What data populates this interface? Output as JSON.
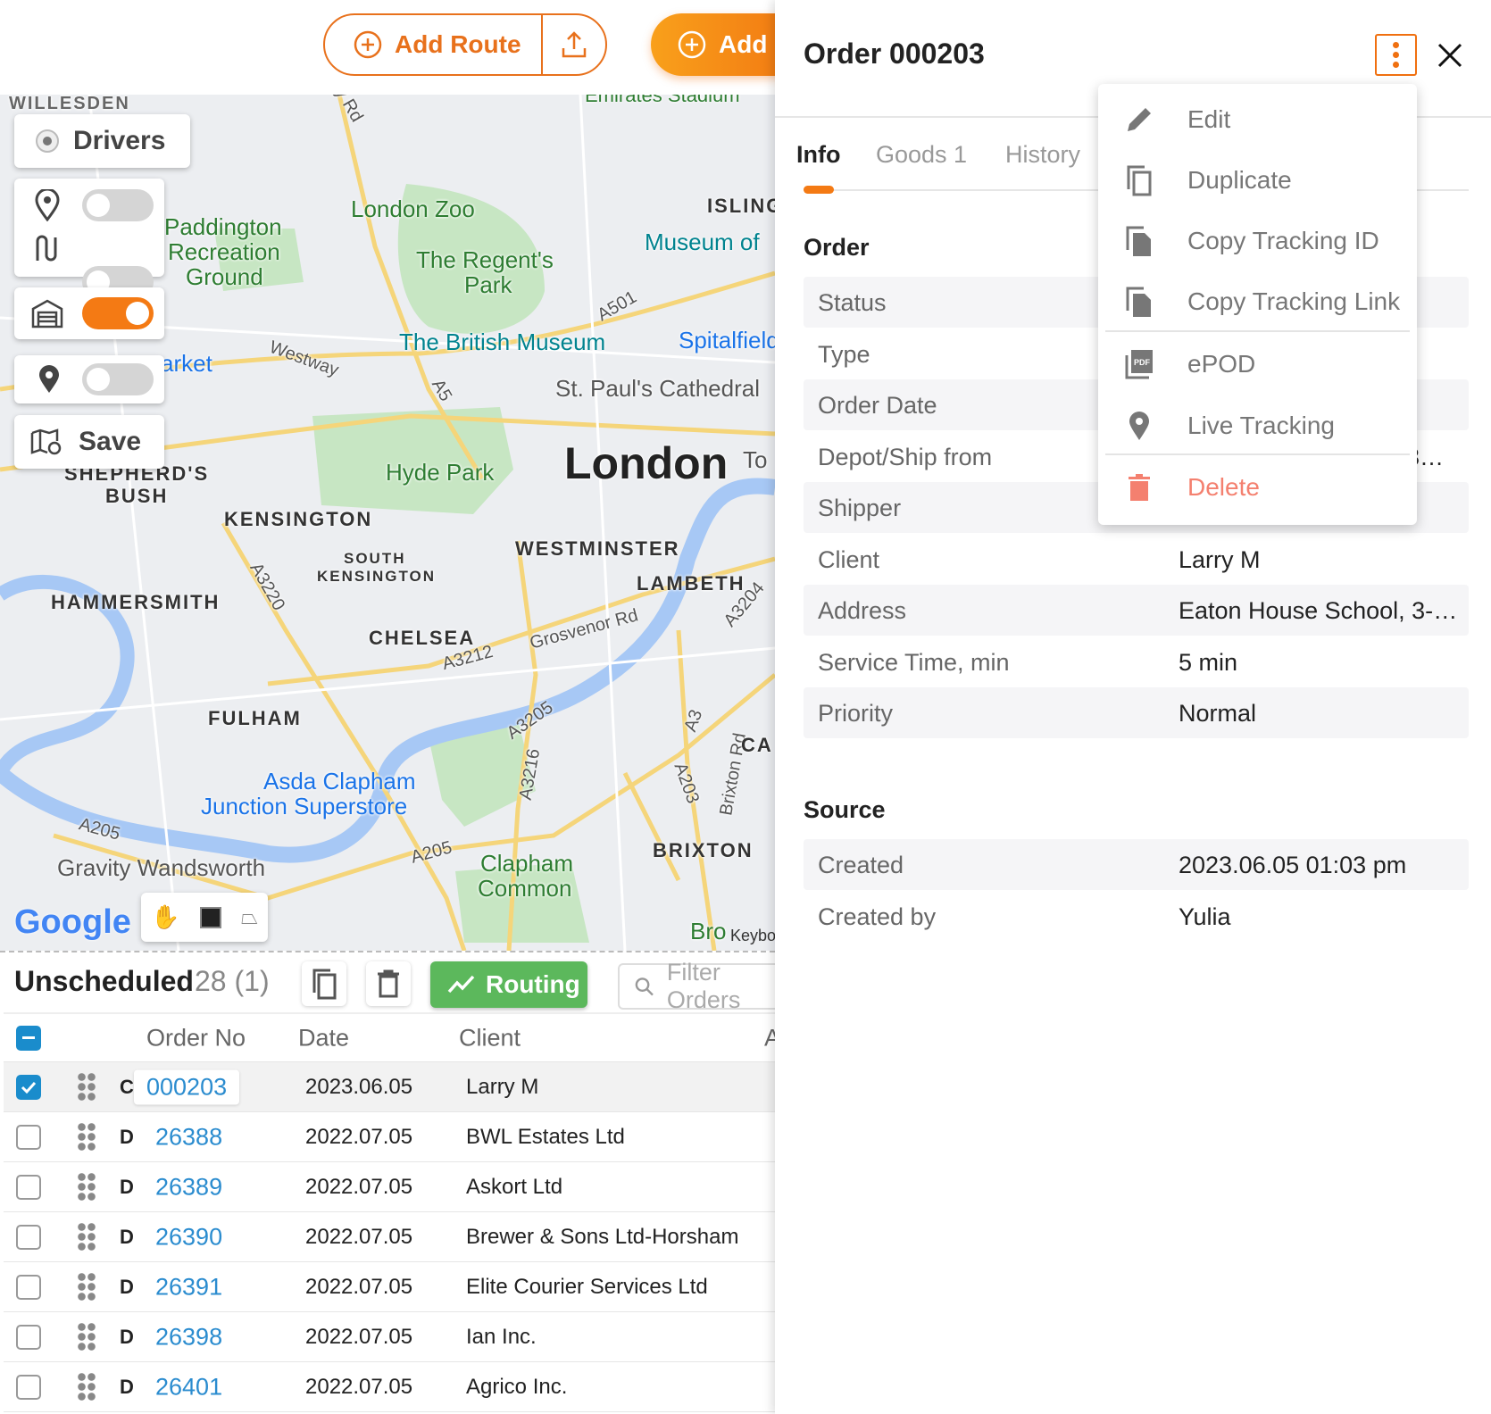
{
  "toolbar": {
    "add_route": "Add Route",
    "add": "Add",
    "accent": "#e8711c"
  },
  "map": {
    "drivers_label": "Drivers",
    "save_label": "Save",
    "google": "Google",
    "keyboard": "Keybo",
    "labels": [
      "London Zoo",
      "Paddington",
      "Recreation",
      "Ground",
      "The Regent's",
      "Park",
      "ISLINGTON",
      "Museum of",
      "The British Museum",
      "Spitalfields",
      "St. Paul's Cathedral",
      "Hyde Park",
      "London",
      "WESTMINSTER",
      "LAMBETH",
      "KENSINGTON",
      "SOUTH",
      "KENSINGTON",
      "HAMMERSMITH",
      "CHELSEA",
      "FULHAM",
      "Asda Clapham",
      "Junction Superstore",
      "Gravity Wandsworth",
      "Clapham",
      "Common",
      "BRIXTON",
      "SHEPHERD'S",
      "BUSH",
      "Westway",
      "arket",
      "A501",
      "A5",
      "A3220",
      "A3212",
      "Grosvenor Rd",
      "A3205",
      "A3216",
      "A3",
      "A203",
      "Brixton Rd",
      "A3204",
      "A205",
      "A205",
      "Bro",
      "CA",
      "To",
      "WILLESDEN",
      "Emirates Stadium",
      "y Rd"
    ]
  },
  "bottom": {
    "title": "Unscheduled",
    "count": "28 (1)",
    "routing": "Routing",
    "filter_placeholder": "Filter Orders",
    "columns": [
      "Order No",
      "Date",
      "Client",
      "A"
    ],
    "rows": [
      {
        "type": "C",
        "order_no": "000203",
        "date": "2023.06.05",
        "client": "Larry M",
        "checked": true
      },
      {
        "type": "D",
        "order_no": "26388",
        "date": "2022.07.05",
        "client": "BWL Estates Ltd",
        "checked": false
      },
      {
        "type": "D",
        "order_no": "26389",
        "date": "2022.07.05",
        "client": "Askort Ltd",
        "checked": false
      },
      {
        "type": "D",
        "order_no": "26390",
        "date": "2022.07.05",
        "client": "Brewer & Sons Ltd-Horsham",
        "checked": false
      },
      {
        "type": "D",
        "order_no": "26391",
        "date": "2022.07.05",
        "client": "Elite Courier Services Ltd",
        "checked": false
      },
      {
        "type": "D",
        "order_no": "26398",
        "date": "2022.07.05",
        "client": "Ian Inc.",
        "checked": false
      },
      {
        "type": "D",
        "order_no": "26401",
        "date": "2022.07.05",
        "client": "Agrico Inc.",
        "checked": false
      }
    ]
  },
  "panel": {
    "title": "Order 000203",
    "tabs": [
      "Info",
      "Goods 1",
      "History"
    ],
    "order_heading": "Order",
    "order_fields": [
      {
        "label": "Status",
        "value": ""
      },
      {
        "label": "Type",
        "value": ""
      },
      {
        "label": "Order Date",
        "value": ""
      },
      {
        "label": "Depot/Ship from",
        "value": "3…"
      },
      {
        "label": "Shipper",
        "value": ""
      },
      {
        "label": "Client",
        "value": "Larry M"
      },
      {
        "label": "Address",
        "value": "Eaton House School, 3-5 …"
      },
      {
        "label": "Service Time, min",
        "value": "5 min"
      },
      {
        "label": "Priority",
        "value": "Normal"
      }
    ],
    "source_heading": "Source",
    "source_fields": [
      {
        "label": "Created",
        "value": "2023.06.05 01:03 pm"
      },
      {
        "label": "Created by",
        "value": "Yulia"
      }
    ]
  },
  "menu": {
    "items": [
      "Edit",
      "Duplicate",
      "Copy Tracking ID",
      "Copy Tracking Link",
      "ePOD",
      "Live Tracking",
      "Delete"
    ],
    "delete_color": "#f4806f"
  }
}
